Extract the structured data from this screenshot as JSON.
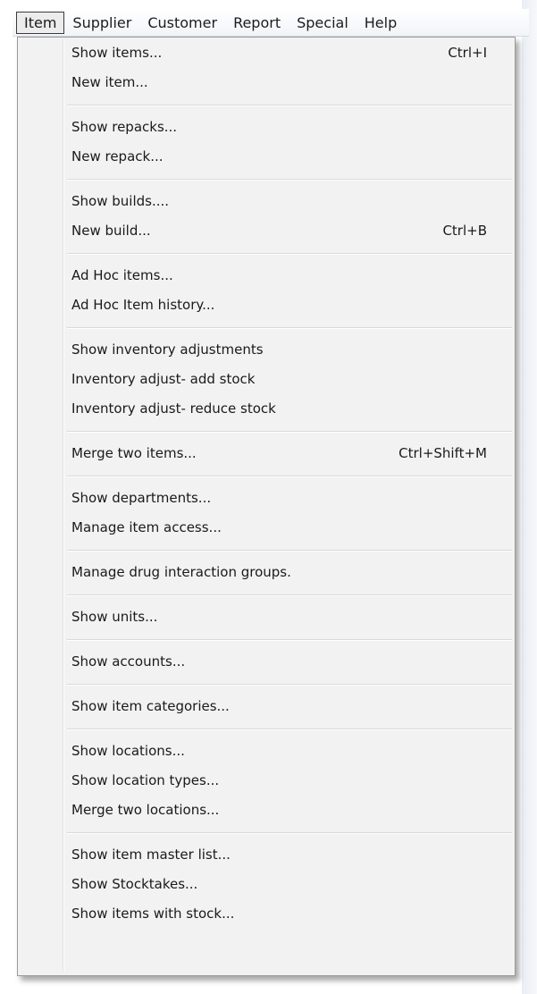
{
  "menubar": {
    "items": [
      "Item",
      "Supplier",
      "Customer",
      "Report",
      "Special",
      "Help"
    ],
    "open_index": 0
  },
  "dropdown": {
    "groups": [
      [
        {
          "label": "Show items...",
          "shortcut": "Ctrl+I"
        },
        {
          "label": "New item...",
          "shortcut": ""
        }
      ],
      [
        {
          "label": "Show repacks...",
          "shortcut": ""
        },
        {
          "label": "New repack...",
          "shortcut": ""
        }
      ],
      [
        {
          "label": "Show builds....",
          "shortcut": ""
        },
        {
          "label": "New build...",
          "shortcut": "Ctrl+B"
        }
      ],
      [
        {
          "label": "Ad Hoc items...",
          "shortcut": ""
        },
        {
          "label": "Ad Hoc Item history...",
          "shortcut": ""
        }
      ],
      [
        {
          "label": "Show inventory adjustments",
          "shortcut": ""
        },
        {
          "label": "Inventory adjust- add stock",
          "shortcut": ""
        },
        {
          "label": "Inventory adjust- reduce stock",
          "shortcut": ""
        }
      ],
      [
        {
          "label": "Merge two items...",
          "shortcut": "Ctrl+Shift+M"
        }
      ],
      [
        {
          "label": "Show departments...",
          "shortcut": ""
        },
        {
          "label": "Manage item access...",
          "shortcut": ""
        }
      ],
      [
        {
          "label": "Manage drug interaction groups.",
          "shortcut": ""
        }
      ],
      [
        {
          "label": "Show units...",
          "shortcut": ""
        }
      ],
      [
        {
          "label": "Show accounts...",
          "shortcut": ""
        }
      ],
      [
        {
          "label": "Show item categories...",
          "shortcut": ""
        }
      ],
      [
        {
          "label": "Show locations...",
          "shortcut": ""
        },
        {
          "label": "Show location types...",
          "shortcut": ""
        },
        {
          "label": "Merge two locations...",
          "shortcut": ""
        }
      ],
      [
        {
          "label": "Show item master list...",
          "shortcut": ""
        },
        {
          "label": "Show Stocktakes...",
          "shortcut": ""
        },
        {
          "label": "Show items with stock...",
          "shortcut": ""
        }
      ]
    ]
  }
}
